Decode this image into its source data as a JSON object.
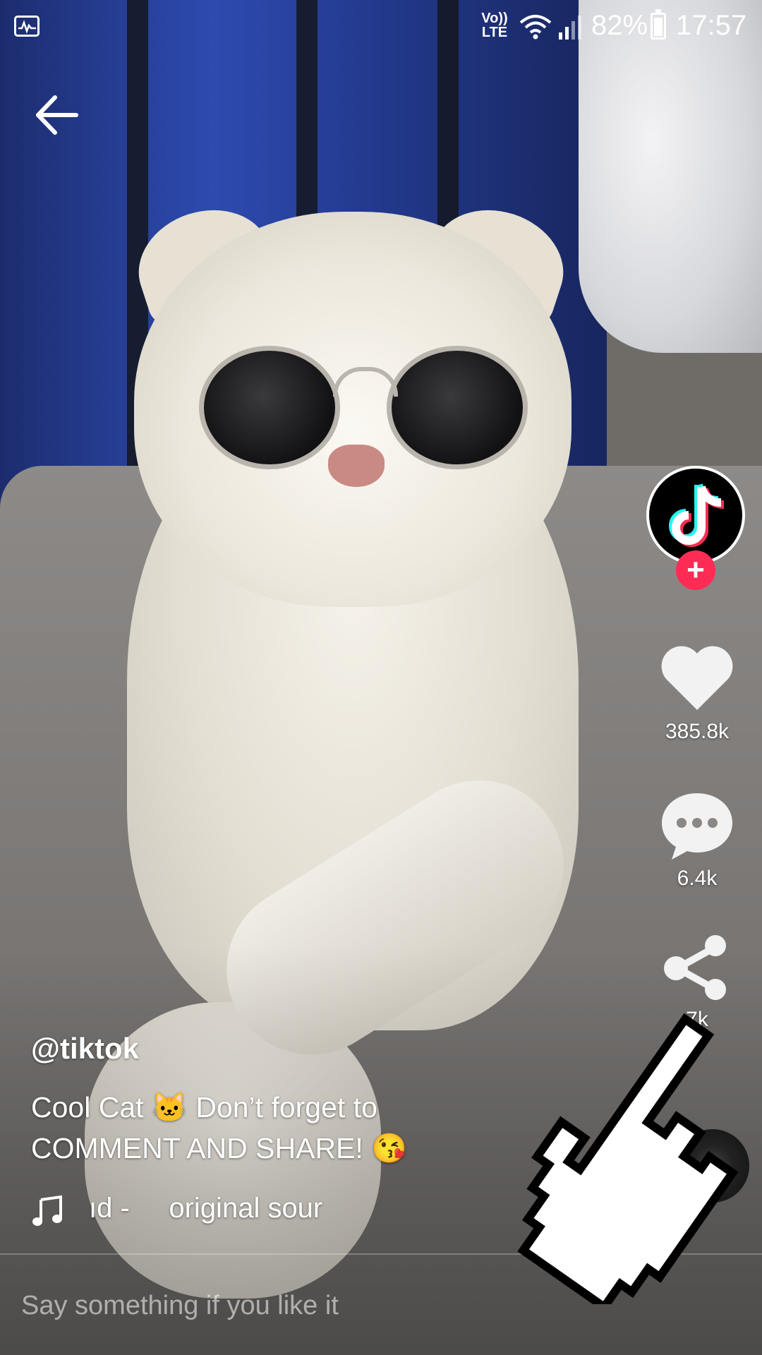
{
  "status_bar": {
    "volte_top": "Vo))",
    "volte_bottom": "LTE",
    "battery": "82%",
    "time": "17:57"
  },
  "video": {
    "description_icons": [
      "activity-icon",
      "back-arrow-icon"
    ]
  },
  "creator": {
    "avatar_icon": "tiktok-logo-icon",
    "follow_symbol": "+"
  },
  "actions": {
    "likes": "385.8k",
    "comments": "6.4k",
    "shares": "7k"
  },
  "post": {
    "username": "@tiktok",
    "caption_line1": "Cool Cat 🐱 Don’t forget to",
    "caption_line2": "COMMENT AND SHARE! 😘",
    "sound": "ıd -     original sour"
  },
  "comment_box": {
    "placeholder": "Say something if you like it"
  },
  "colors": {
    "accent": "#fe2c55",
    "tiktok_cyan": "#25f4ee",
    "tiktok_red": "#fe2c55"
  }
}
